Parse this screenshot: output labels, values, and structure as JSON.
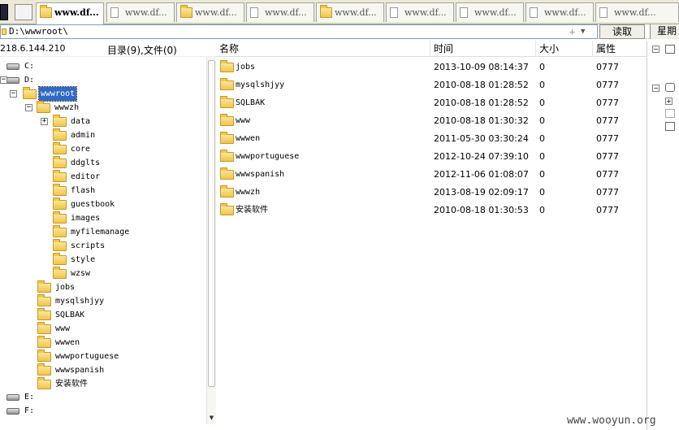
{
  "tabs": [
    {
      "label": "www.df..."
    },
    {
      "label": "www.df..."
    },
    {
      "label": "www.df..."
    },
    {
      "label": "www.df..."
    },
    {
      "label": "www.df..."
    },
    {
      "label": "www.df..."
    },
    {
      "label": "www.df..."
    },
    {
      "label": "www.df..."
    },
    {
      "label": "www.df..."
    }
  ],
  "address": {
    "path": "D:\\wwwroot\\",
    "read_label": "读取",
    "week_label": "星期"
  },
  "tree_header": {
    "ip": "218.6.144.210",
    "count": "目录(9),文件(0)"
  },
  "tree": [
    {
      "label": "C:",
      "kind": "drive"
    },
    {
      "label": "D:",
      "kind": "drive",
      "toggle": "-"
    },
    {
      "label": "wwwroot",
      "kind": "folder",
      "toggle": "-",
      "selected": true
    },
    {
      "label": "wwwzh",
      "kind": "folder",
      "toggle": "-"
    },
    {
      "label": "data",
      "kind": "folder",
      "toggle": "+"
    },
    {
      "label": "admin",
      "kind": "folder"
    },
    {
      "label": "core",
      "kind": "folder"
    },
    {
      "label": "ddglts",
      "kind": "folder"
    },
    {
      "label": "editor",
      "kind": "folder"
    },
    {
      "label": "flash",
      "kind": "folder"
    },
    {
      "label": "guestbook",
      "kind": "folder"
    },
    {
      "label": "images",
      "kind": "folder"
    },
    {
      "label": "myfilemanage",
      "kind": "folder"
    },
    {
      "label": "scripts",
      "kind": "folder"
    },
    {
      "label": "style",
      "kind": "folder"
    },
    {
      "label": "wzsw",
      "kind": "folder"
    },
    {
      "label": "jobs",
      "kind": "folder"
    },
    {
      "label": "mysqlshjyy",
      "kind": "folder"
    },
    {
      "label": "SQLBAK",
      "kind": "folder"
    },
    {
      "label": "www",
      "kind": "folder"
    },
    {
      "label": "wwwen",
      "kind": "folder"
    },
    {
      "label": "wwwportuguese",
      "kind": "folder"
    },
    {
      "label": "wwwspanish",
      "kind": "folder"
    },
    {
      "label": "安装软件",
      "kind": "folder"
    },
    {
      "label": "E:",
      "kind": "drive"
    },
    {
      "label": "F:",
      "kind": "drive"
    }
  ],
  "columns": {
    "name": "名称",
    "time": "时间",
    "size": "大小",
    "attr": "属性"
  },
  "files": [
    {
      "name": "jobs",
      "time": "2013-10-09 08:14:37",
      "size": "0",
      "attr": "0777"
    },
    {
      "name": "mysqlshjyy",
      "time": "2010-08-18 01:28:52",
      "size": "0",
      "attr": "0777"
    },
    {
      "name": "SQLBAK",
      "time": "2010-08-18 01:28:52",
      "size": "0",
      "attr": "0777"
    },
    {
      "name": "www",
      "time": "2010-08-18 01:30:32",
      "size": "0",
      "attr": "0777"
    },
    {
      "name": "wwwen",
      "time": "2011-05-30 03:30:24",
      "size": "0",
      "attr": "0777"
    },
    {
      "name": "wwwportuguese",
      "time": "2012-10-24 07:39:10",
      "size": "0",
      "attr": "0777"
    },
    {
      "name": "wwwspanish",
      "time": "2012-11-06 01:08:07",
      "size": "0",
      "attr": "0777"
    },
    {
      "name": "wwwzh",
      "time": "2013-08-19 02:09:17",
      "size": "0",
      "attr": "0777"
    },
    {
      "name": "安装软件",
      "time": "2010-08-18 01:30:53",
      "size": "0",
      "attr": "0777"
    }
  ],
  "watermark": "www.wooyun.org",
  "icons": [
    "app-icon",
    "folder-icon",
    "page-icon",
    "drive-icon",
    "expand-icon",
    "collapse-icon"
  ]
}
